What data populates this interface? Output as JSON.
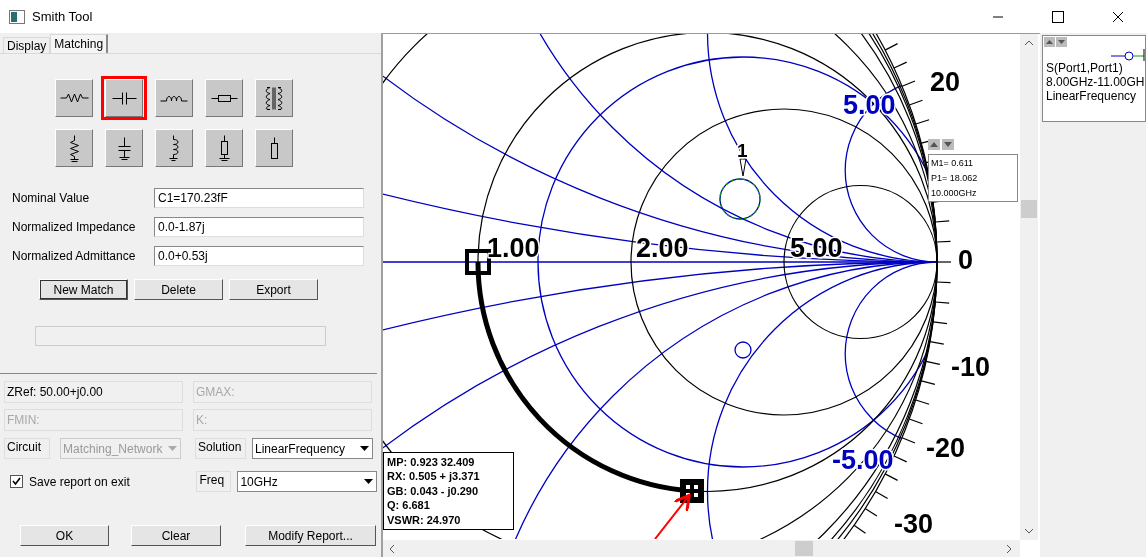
{
  "window": {
    "title": "Smith Tool"
  },
  "tabs": [
    {
      "label": "Display",
      "selected": false
    },
    {
      "label": "Matching",
      "selected": true
    }
  ],
  "components": [
    {
      "kind": "series-resistor",
      "selected": false
    },
    {
      "kind": "series-capacitor",
      "selected": true
    },
    {
      "kind": "series-inductor",
      "selected": false
    },
    {
      "kind": "series-line",
      "selected": false
    },
    {
      "kind": "transformer",
      "selected": false
    },
    {
      "kind": "shunt-resistor",
      "selected": false
    },
    {
      "kind": "shunt-capacitor",
      "selected": false
    },
    {
      "kind": "shunt-inductor",
      "selected": false
    },
    {
      "kind": "shunt-line",
      "selected": false
    },
    {
      "kind": "open-stub",
      "selected": false
    }
  ],
  "fields": [
    {
      "label": "Nominal Value",
      "value": "C1=170.23fF"
    },
    {
      "label": "Normalized Impedance",
      "value": "0.0-1.87j"
    },
    {
      "label": "Normalized Admittance",
      "value": "0.0+0.53j"
    }
  ],
  "actions": [
    "New Match",
    "Delete",
    "Export"
  ],
  "readouts": [
    {
      "text": "ZRef: 50.00+j0.00",
      "disabled": false
    },
    {
      "text": "GMAX:",
      "disabled": true
    },
    {
      "text": "FMIN:",
      "disabled": true
    },
    {
      "text": "K:",
      "disabled": true
    }
  ],
  "circuit": {
    "label": "Circuit",
    "value": "Matching_Network",
    "disabled": true
  },
  "solution": {
    "label": "Solution",
    "value": "LinearFrequency",
    "disabled": false
  },
  "save_report": {
    "label": "Save report on exit",
    "checked": true
  },
  "freq": {
    "label": "Freq",
    "value": "10GHz",
    "disabled": false
  },
  "buttons": [
    "OK",
    "Clear",
    "Modify Report..."
  ],
  "chart": {
    "resistance_labels": [
      "1.00",
      "2.00",
      "5.00"
    ],
    "reactance_labels": [
      "5.00",
      "-5.00"
    ],
    "scale_labels": [
      "20",
      "0",
      "-10",
      "-20",
      "-30"
    ],
    "marker_label": "1",
    "marker_readout": [
      "M1= 0.611",
      "P1= 18.062",
      "10.000GHz"
    ],
    "point_readout": [
      "MP: 0.923  32.409",
      "RX: 0.505 + j3.371",
      "GB: 0.043 - j0.290",
      "Q: 6.681",
      "VSWR: 24.970"
    ]
  },
  "legend": {
    "lines": [
      "S(Port1,Port1)",
      "8.00GHz-11.00GH",
      "LinearFrequency"
    ]
  }
}
